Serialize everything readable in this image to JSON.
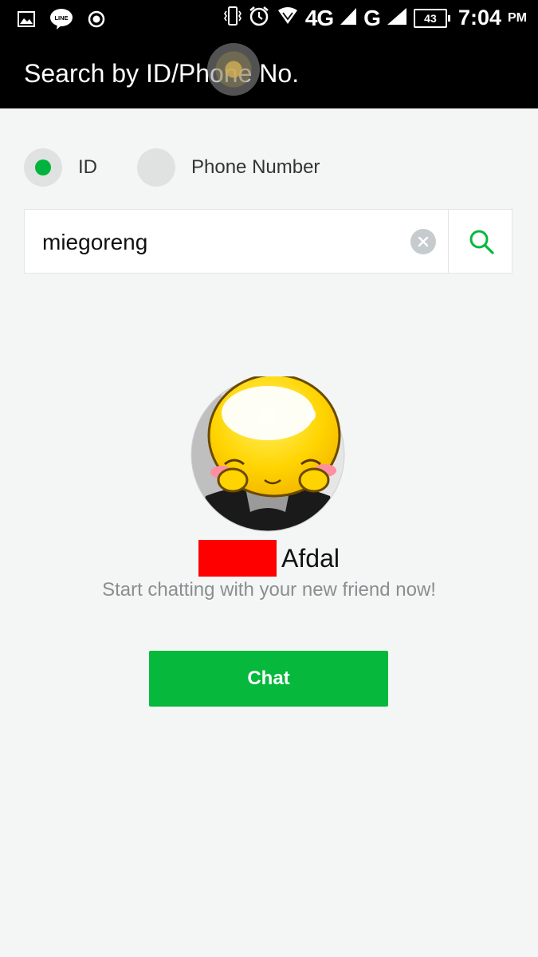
{
  "status_bar": {
    "network_4g": "4G",
    "network_g": "G",
    "battery_level": "43",
    "time": "7:04",
    "time_suffix": "PM"
  },
  "app_bar": {
    "title": "Search by ID/Phone No."
  },
  "search_type": {
    "options": [
      {
        "label": "ID",
        "selected": true
      },
      {
        "label": "Phone Number",
        "selected": false
      }
    ]
  },
  "search": {
    "value": "miegoreng",
    "placeholder": ""
  },
  "result": {
    "name": "Afdal",
    "message": "Start chatting with your new friend now!",
    "chat_button_label": "Chat"
  },
  "colors": {
    "accent_green": "#06b83c",
    "redaction": "#ff0000",
    "background": "#f3f6f5"
  }
}
